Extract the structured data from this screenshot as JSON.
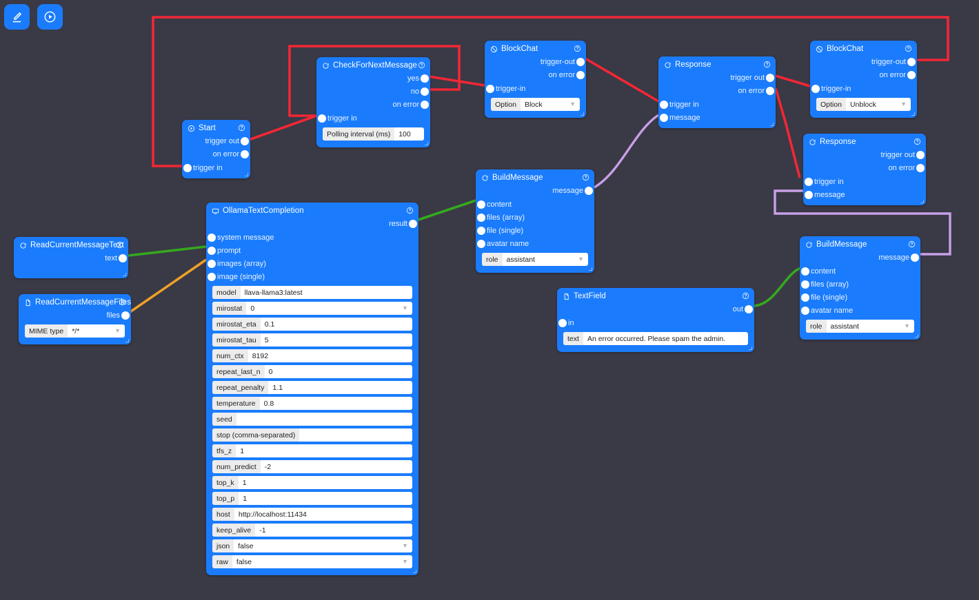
{
  "app": {
    "background_color": "#3a3946",
    "node_color": "#1a7cfc"
  },
  "toolbar": {
    "buttons": [
      {
        "name": "edit-button",
        "icon": "pencil-icon",
        "label": "Edit"
      },
      {
        "name": "run-button",
        "icon": "play-circle-icon",
        "label": "Run"
      }
    ]
  },
  "edge_colors": {
    "trigger": "#f32735",
    "text": "#35a81f",
    "files": "#f0a028",
    "message": "#c9a0e8"
  },
  "nodes": {
    "start": {
      "title": "Start",
      "icon": "play-circle-icon",
      "outputs": [
        "trigger out",
        "on error"
      ],
      "inputs": [
        "trigger in"
      ]
    },
    "check_next_message": {
      "title": "CheckForNextMessage",
      "icon": "chat-icon",
      "outputs": [
        "yes",
        "no",
        "on error"
      ],
      "inputs": [
        "trigger in"
      ],
      "fields": [
        {
          "label": "Polling interval (ms)",
          "value": "100",
          "type": "text"
        }
      ]
    },
    "block_chat_1": {
      "title": "BlockChat",
      "icon": "block-icon",
      "outputs": [
        "trigger-out",
        "on error"
      ],
      "inputs": [
        "trigger-in"
      ],
      "fields": [
        {
          "label": "Option",
          "value": "Block",
          "type": "select"
        }
      ]
    },
    "response_1": {
      "title": "Response",
      "icon": "chat-icon",
      "outputs": [
        "trigger out",
        "on error"
      ],
      "inputs": [
        "trigger in",
        "message"
      ]
    },
    "block_chat_2": {
      "title": "BlockChat",
      "icon": "block-icon",
      "outputs": [
        "trigger-out",
        "on error"
      ],
      "inputs": [
        "trigger-in"
      ],
      "fields": [
        {
          "label": "Option",
          "value": "Unblock",
          "type": "select"
        }
      ]
    },
    "response_2": {
      "title": "Response",
      "icon": "chat-icon",
      "outputs": [
        "trigger out",
        "on error"
      ],
      "inputs": [
        "trigger in",
        "message"
      ]
    },
    "build_message_1": {
      "title": "BuildMessage",
      "icon": "chat-icon",
      "outputs": [
        "message"
      ],
      "inputs": [
        "content",
        "files (array)",
        "file (single)",
        "avatar name"
      ],
      "fields": [
        {
          "label": "role",
          "value": "assistant",
          "type": "select"
        }
      ]
    },
    "build_message_2": {
      "title": "BuildMessage",
      "icon": "chat-icon",
      "outputs": [
        "message"
      ],
      "inputs": [
        "content",
        "files (array)",
        "file (single)",
        "avatar name"
      ],
      "fields": [
        {
          "label": "role",
          "value": "assistant",
          "type": "select"
        }
      ]
    },
    "text_field": {
      "title": "TextField",
      "icon": "document-icon",
      "outputs": [
        "out"
      ],
      "inputs": [
        "in"
      ],
      "fields": [
        {
          "label": "text",
          "value": "An error occurred. Please spam the admin.",
          "type": "text"
        }
      ]
    },
    "read_current_message_text": {
      "title": "ReadCurrentMessageText",
      "icon": "chat-icon",
      "outputs": [
        "text"
      ],
      "inputs": []
    },
    "read_current_message_files": {
      "title": "ReadCurrentMessageFiles",
      "icon": "document-icon",
      "outputs": [
        "files"
      ],
      "inputs": [],
      "fields": [
        {
          "label": "MIME type",
          "value": "*/*",
          "type": "select"
        }
      ]
    },
    "ollama_text_completion": {
      "title": "OllamaTextCompletion",
      "icon": "monitor-icon",
      "outputs": [
        "result"
      ],
      "inputs": [
        "system message",
        "prompt",
        "images (array)",
        "image (single)"
      ],
      "fields": [
        {
          "label": "model",
          "value": "llava-llama3:latest",
          "type": "text"
        },
        {
          "label": "mirostat",
          "value": "0",
          "type": "select"
        },
        {
          "label": "mirostat_eta",
          "value": "0.1",
          "type": "text"
        },
        {
          "label": "mirostat_tau",
          "value": "5",
          "type": "text"
        },
        {
          "label": "num_ctx",
          "value": "8192",
          "type": "text"
        },
        {
          "label": "repeat_last_n",
          "value": "0",
          "type": "text"
        },
        {
          "label": "repeat_penalty",
          "value": "1.1",
          "type": "text"
        },
        {
          "label": "temperature",
          "value": "0.8",
          "type": "text"
        },
        {
          "label": "seed",
          "value": "",
          "type": "text"
        },
        {
          "label": "stop (comma-separated)",
          "value": "",
          "type": "text"
        },
        {
          "label": "tfs_z",
          "value": "1",
          "type": "text"
        },
        {
          "label": "num_predict",
          "value": "-2",
          "type": "text"
        },
        {
          "label": "top_k",
          "value": "1",
          "type": "text"
        },
        {
          "label": "top_p",
          "value": "1",
          "type": "text"
        },
        {
          "label": "host",
          "value": "http://localhost:11434",
          "type": "text"
        },
        {
          "label": "keep_alive",
          "value": "-1",
          "type": "text"
        },
        {
          "label": "json",
          "value": "false",
          "type": "select"
        },
        {
          "label": "raw",
          "value": "false",
          "type": "select"
        }
      ]
    }
  }
}
